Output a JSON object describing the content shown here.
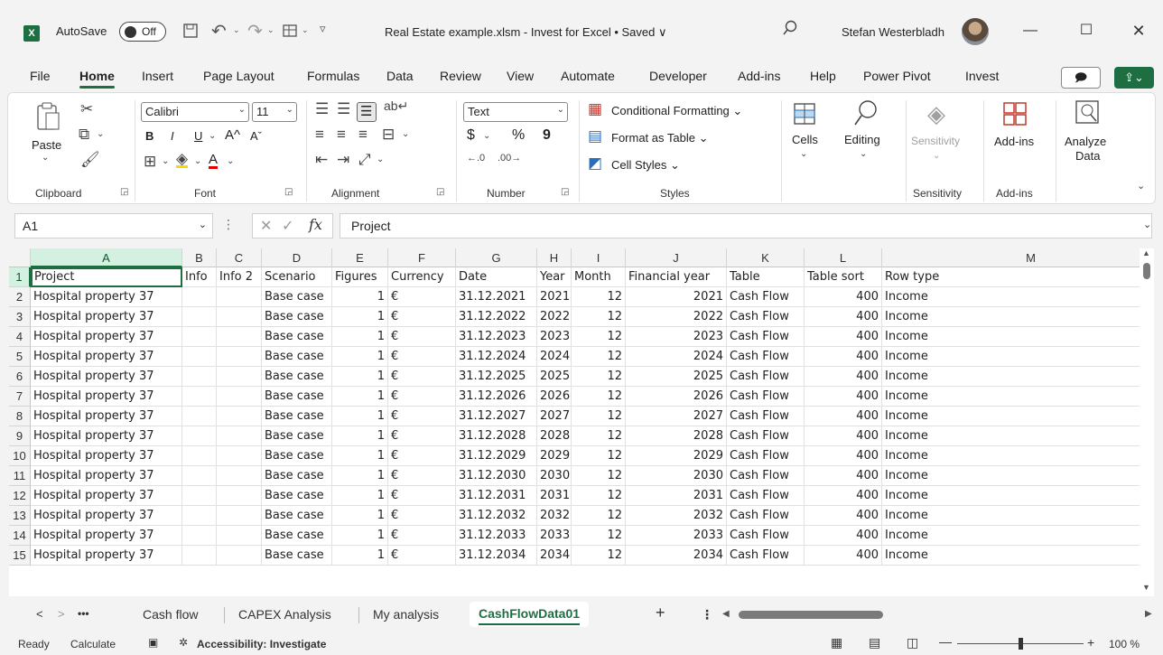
{
  "titlebar": {
    "app_icon": "X",
    "autosave_label": "AutoSave",
    "autosave_state": "Off",
    "doc_title": "Real Estate example.xlsm  -  Invest for Excel • Saved ∨",
    "user_name": "Stefan Westerbladh",
    "icons": [
      "excel-logo",
      "save-icon",
      "undo-icon",
      "redo-icon",
      "sheet-icon",
      "customize-icon",
      "search-icon",
      "minimize-icon",
      "maximize-icon",
      "close-icon"
    ]
  },
  "ribbon_tabs": [
    "File",
    "Home",
    "Insert",
    "Page Layout",
    "Formulas",
    "Data",
    "Review",
    "View",
    "Automate",
    "Developer",
    "Add-ins",
    "Help",
    "Power Pivot",
    "Invest"
  ],
  "ribbon": {
    "clipboard": {
      "paste": "Paste",
      "label": "Clipboard"
    },
    "font": {
      "name": "Calibri",
      "size": "11",
      "label": "Font",
      "bold": "B",
      "italic": "I",
      "underline": "U",
      "grow": "A^",
      "shrink": "Aˇ"
    },
    "alignment": {
      "label": "Alignment"
    },
    "number": {
      "format": "Text",
      "currency": "$",
      "percent": "%",
      "comma": "9",
      "label": "Number"
    },
    "styles": {
      "conditional": "Conditional Formatting ⌄",
      "format_table": "Format as Table ⌄",
      "cell_styles": "Cell Styles ⌄",
      "label": "Styles"
    },
    "cells": {
      "label": "Cells"
    },
    "editing": {
      "label": "Editing"
    },
    "sensitivity": {
      "button": "Sensitivity",
      "label": "Sensitivity"
    },
    "addins": {
      "button": "Add-ins",
      "label": "Add-ins"
    },
    "analyze": {
      "line1": "Analyze",
      "line2": "Data"
    }
  },
  "formula_bar": {
    "name_box": "A1",
    "fx": "fx",
    "value": "Project"
  },
  "sheet": {
    "columns": [
      "A",
      "B",
      "C",
      "D",
      "E",
      "F",
      "G",
      "H",
      "I",
      "J",
      "K",
      "L",
      "M"
    ],
    "header_row": [
      "Project",
      "Info",
      "Info 2",
      "Scenario",
      "Figures",
      "Currency",
      "Date",
      "Year",
      "Month",
      "Financial year",
      "Table",
      "Table sort",
      "Row type"
    ],
    "rows": [
      [
        "Hospital property 37",
        "",
        "",
        "Base case",
        "1",
        "€",
        "31.12.2021",
        "2021",
        "12",
        "2021",
        "Cash Flow",
        "400",
        "Income"
      ],
      [
        "Hospital property 37",
        "",
        "",
        "Base case",
        "1",
        "€",
        "31.12.2022",
        "2022",
        "12",
        "2022",
        "Cash Flow",
        "400",
        "Income"
      ],
      [
        "Hospital property 37",
        "",
        "",
        "Base case",
        "1",
        "€",
        "31.12.2023",
        "2023",
        "12",
        "2023",
        "Cash Flow",
        "400",
        "Income"
      ],
      [
        "Hospital property 37",
        "",
        "",
        "Base case",
        "1",
        "€",
        "31.12.2024",
        "2024",
        "12",
        "2024",
        "Cash Flow",
        "400",
        "Income"
      ],
      [
        "Hospital property 37",
        "",
        "",
        "Base case",
        "1",
        "€",
        "31.12.2025",
        "2025",
        "12",
        "2025",
        "Cash Flow",
        "400",
        "Income"
      ],
      [
        "Hospital property 37",
        "",
        "",
        "Base case",
        "1",
        "€",
        "31.12.2026",
        "2026",
        "12",
        "2026",
        "Cash Flow",
        "400",
        "Income"
      ],
      [
        "Hospital property 37",
        "",
        "",
        "Base case",
        "1",
        "€",
        "31.12.2027",
        "2027",
        "12",
        "2027",
        "Cash Flow",
        "400",
        "Income"
      ],
      [
        "Hospital property 37",
        "",
        "",
        "Base case",
        "1",
        "€",
        "31.12.2028",
        "2028",
        "12",
        "2028",
        "Cash Flow",
        "400",
        "Income"
      ],
      [
        "Hospital property 37",
        "",
        "",
        "Base case",
        "1",
        "€",
        "31.12.2029",
        "2029",
        "12",
        "2029",
        "Cash Flow",
        "400",
        "Income"
      ],
      [
        "Hospital property 37",
        "",
        "",
        "Base case",
        "1",
        "€",
        "31.12.2030",
        "2030",
        "12",
        "2030",
        "Cash Flow",
        "400",
        "Income"
      ],
      [
        "Hospital property 37",
        "",
        "",
        "Base case",
        "1",
        "€",
        "31.12.2031",
        "2031",
        "12",
        "2031",
        "Cash Flow",
        "400",
        "Income"
      ],
      [
        "Hospital property 37",
        "",
        "",
        "Base case",
        "1",
        "€",
        "31.12.2032",
        "2032",
        "12",
        "2032",
        "Cash Flow",
        "400",
        "Income"
      ],
      [
        "Hospital property 37",
        "",
        "",
        "Base case",
        "1",
        "€",
        "31.12.2033",
        "2033",
        "12",
        "2033",
        "Cash Flow",
        "400",
        "Income"
      ],
      [
        "Hospital property 37",
        "",
        "",
        "Base case",
        "1",
        "€",
        "31.12.2034",
        "2034",
        "12",
        "2034",
        "Cash Flow",
        "400",
        "Income"
      ]
    ]
  },
  "sheet_tabs": {
    "items": [
      "Cash flow",
      "CAPEX Analysis",
      "My analysis",
      "CashFlowData01"
    ],
    "active": "CashFlowData01",
    "more": "•••",
    "add": "+"
  },
  "status_bar": {
    "ready": "Ready",
    "calculate": "Calculate",
    "accessibility": "Accessibility: Investigate",
    "zoom": "100 %",
    "zoom_level": 1.0
  },
  "colors": {
    "accent": "#1d6f42",
    "selection": "#d3f0e0"
  }
}
